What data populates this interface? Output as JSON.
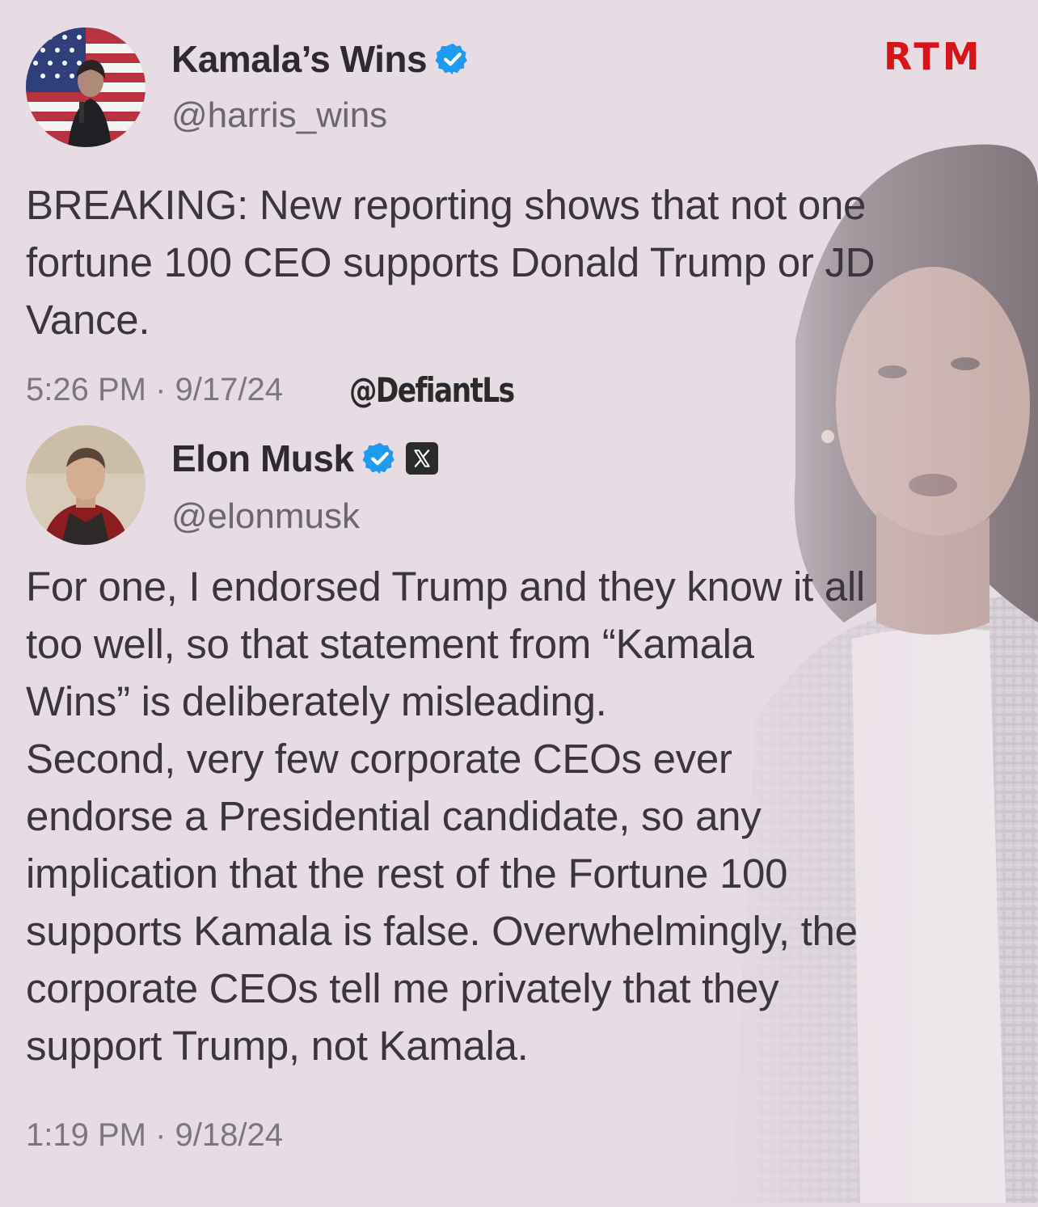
{
  "brand": {
    "logo_text": "RTM",
    "accent_color": "#d7141a"
  },
  "watermark": {
    "handle": "@DefiantLs"
  },
  "tweets": [
    {
      "display_name": "Kamala’s Wins",
      "handle": "@harris_wins",
      "verified": true,
      "avatar_icon": "avatar-flag-podium",
      "text": "BREAKING: New reporting shows that not one\nfortune 100 CEO supports Donald Trump or JD\nVance.",
      "timestamp": "5:26 PM · 9/17/24"
    },
    {
      "display_name": "Elon Musk",
      "handle": "@elonmusk",
      "verified": true,
      "affiliate_badge_icon": "x-logo-icon",
      "avatar_icon": "avatar-portrait",
      "text": "For one, I endorsed Trump and they know it all\ntoo well, so that statement from “Kamala\nWins” is deliberately misleading.\nSecond, very few corporate CEOs ever\nendorse a Presidential candidate, so any\nimplication that the rest of the Fortune 100\nsupports Kamala is false. Overwhelmingly, the\ncorporate CEOs tell me privately that they\nsupport Trump, not Kamala.",
      "timestamp": "1:19 PM · 9/18/24"
    }
  ],
  "colors": {
    "background": "#e7dce4",
    "verified_blue": "#1d9bf0",
    "text": "#3a3540",
    "secondary_text": "#6b6670"
  }
}
